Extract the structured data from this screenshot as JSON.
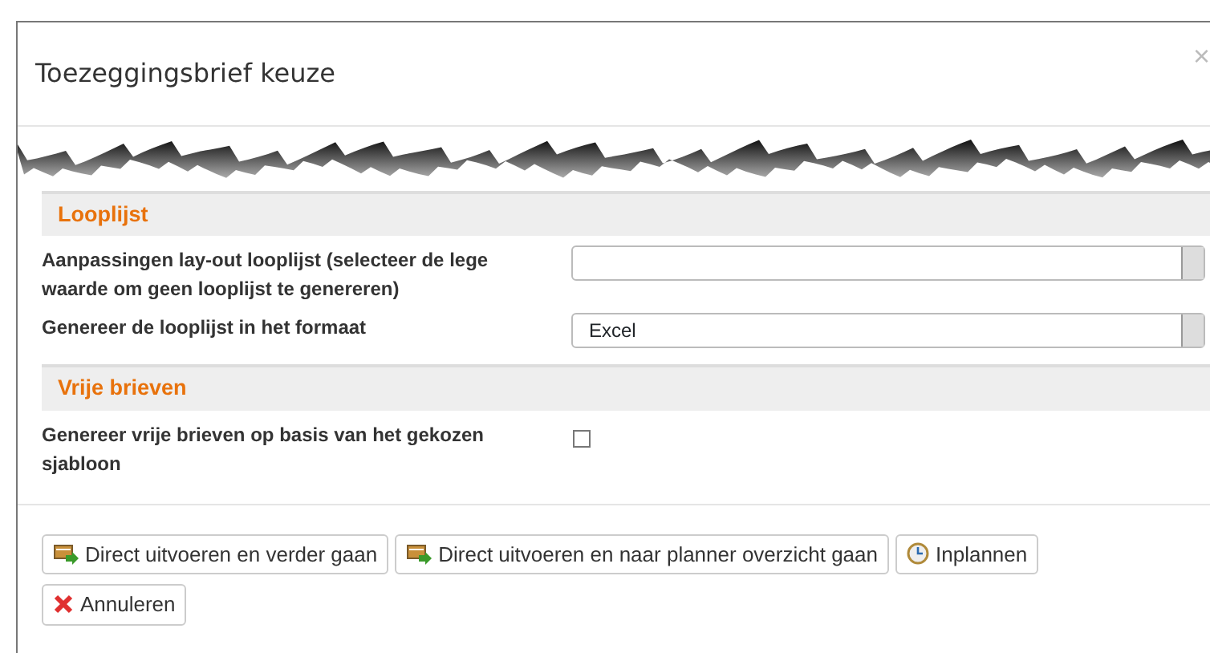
{
  "dialog": {
    "title": "Toezeggingsbrief keuze",
    "close": "×"
  },
  "sections": [
    {
      "title": "Looplijst",
      "fields": [
        {
          "kind": "select",
          "label": "Aanpassingen lay-out looplijst (selecteer de lege waarde om geen looplijst te genereren)"
        },
        {
          "kind": "select",
          "label": "Genereer de looplijst in het formaat",
          "value": "Excel"
        }
      ]
    },
    {
      "title": "Vrije brieven",
      "fields": [
        {
          "kind": "checkbox",
          "label": "Genereer vrije brieven op basis van het gekozen sjabloon",
          "checked": false
        }
      ]
    }
  ],
  "buttons": [
    {
      "kind": "run",
      "label": "Direct uitvoeren en verder gaan"
    },
    {
      "kind": "run",
      "label": "Direct uitvoeren en naar planner overzicht gaan"
    },
    {
      "kind": "schedule",
      "label": "Inplannen"
    },
    {
      "kind": "cancel",
      "label": "Annuleren"
    }
  ]
}
